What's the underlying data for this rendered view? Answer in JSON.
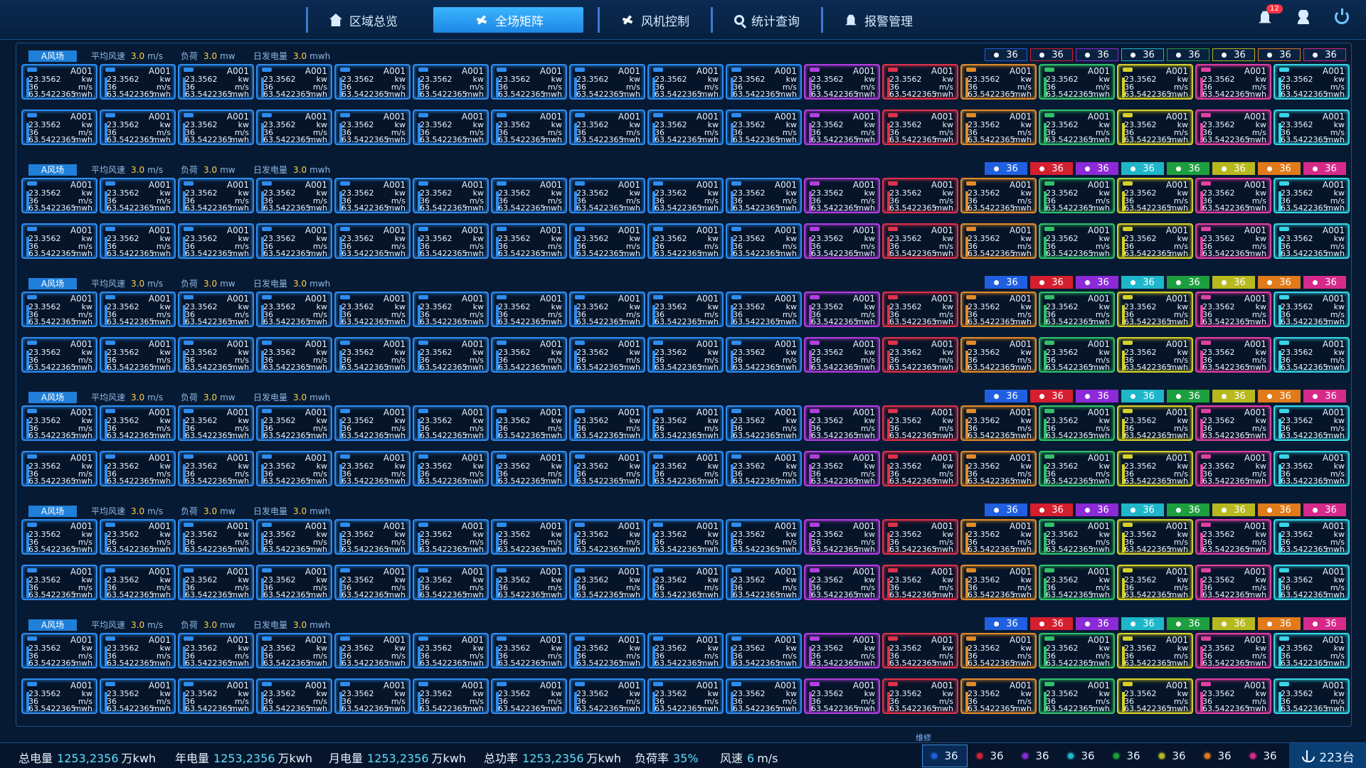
{
  "nav": {
    "items": [
      {
        "label": "区域总览",
        "icon": "home-icon",
        "active": false
      },
      {
        "label": "全场矩阵",
        "icon": "fan-icon",
        "active": true
      },
      {
        "label": "风机控制",
        "icon": "fan-icon",
        "active": false
      },
      {
        "label": "统计查询",
        "icon": "search-icon",
        "active": false
      },
      {
        "label": "报警管理",
        "icon": "bell-icon",
        "active": false
      }
    ],
    "notification_count": "12"
  },
  "group_header": {
    "farm": "A风场",
    "avg_wind_label": "平均风速",
    "avg_wind_value": "3.0",
    "avg_wind_unit": "m/s",
    "load_label": "负荷",
    "load_value": "3.0",
    "load_unit": "mw",
    "daily_label": "日发电量",
    "daily_value": "3.0",
    "daily_unit": "mwh"
  },
  "legend": [
    {
      "color": "#1f5fe0",
      "count": "36"
    },
    {
      "color": "#d41f2f",
      "count": "36"
    },
    {
      "color": "#8b2ad6",
      "count": "36"
    },
    {
      "color": "#1fb6c9",
      "count": "36"
    },
    {
      "color": "#1d9f3f",
      "count": "36"
    },
    {
      "color": "#b7b91f",
      "count": "36"
    },
    {
      "color": "#e07a1a",
      "count": "36"
    },
    {
      "color": "#d62a8a",
      "count": "36"
    }
  ],
  "card": {
    "id": "A001",
    "power": "23.3562",
    "power_unit": "kw",
    "speed": "36",
    "speed_unit": "m/s",
    "energy": "63.5422365",
    "energy_unit": "mwh"
  },
  "card_colors": [
    "#2d8cf0",
    "#2d8cf0",
    "#2d8cf0",
    "#2d8cf0",
    "#2d8cf0",
    "#2d8cf0",
    "#2d8cf0",
    "#2d8cf0",
    "#2d8cf0",
    "#2d8cf0",
    "#b23ee0",
    "#e0304a",
    "#e08a2a",
    "#31c06a",
    "#d4d02a",
    "#e23fa2",
    "#38d5e8"
  ],
  "repair_label": "维修",
  "footer": {
    "total_label": "总电量",
    "total_value": "1253,2356",
    "total_unit": "万kwh",
    "year_label": "年电量",
    "year_value": "1253,2356",
    "year_unit": "万kwh",
    "month_label": "月电量",
    "month_value": "1253,2356",
    "month_unit": "万kwh",
    "power_label": "总功率",
    "power_value": "1253,2356",
    "power_unit": "万kwh",
    "loadrate_label": "负荷率",
    "loadrate_value": "35%",
    "wind_label": "风速",
    "wind_value": "6",
    "wind_unit": "m/s",
    "legend_count": "36",
    "turbines": "223台"
  }
}
